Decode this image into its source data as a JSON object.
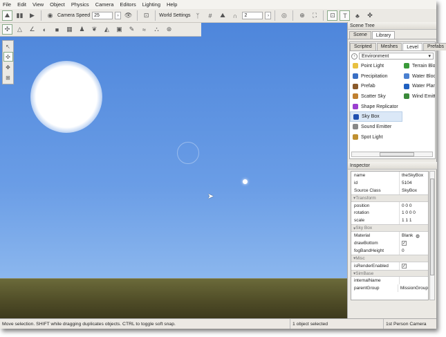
{
  "menu": [
    "File",
    "Edit",
    "View",
    "Object",
    "Physics",
    "Camera",
    "Editors",
    "Lighting",
    "Help"
  ],
  "toolbar": {
    "camera_speed_label": "Camera Speed",
    "camera_speed": "25",
    "world_settings_label": "World Settings",
    "snap_value": "2"
  },
  "scene_tree": {
    "title": "Scene Tree",
    "tabs": [
      "Scene",
      "Library"
    ],
    "active_tab": "Library",
    "sub_tabs": [
      "Scripted",
      "Meshes",
      "Level",
      "Prefabs"
    ],
    "active_sub_tab": "Level",
    "category": "Environment",
    "items_left": [
      {
        "label": "Point Light",
        "color": "#e8c040"
      },
      {
        "label": "Precipitation",
        "color": "#3a6fc4"
      },
      {
        "label": "Prefab",
        "color": "#8a5a2a"
      },
      {
        "label": "Scatter Sky",
        "color": "#c08030"
      },
      {
        "label": "Shape Replicator",
        "color": "#9b3fd0"
      },
      {
        "label": "Sky Box",
        "color": "#2050b0"
      },
      {
        "label": "Sound Emitter",
        "color": "#888888"
      },
      {
        "label": "Spot Light",
        "color": "#c09030"
      }
    ],
    "items_right": [
      {
        "label": "Terrain Block",
        "color": "#3a9a3a"
      },
      {
        "label": "Water Block",
        "color": "#4a80d0"
      },
      {
        "label": "Water Plane",
        "color": "#2060c0"
      },
      {
        "label": "Wind Emitter",
        "color": "#3a8a3a"
      }
    ],
    "selected_item": "Sky Box"
  },
  "inspector": {
    "title": "Inspector",
    "top": [
      {
        "k": "name",
        "v": "theSkyBox"
      },
      {
        "k": "id",
        "v": "5104"
      },
      {
        "k": "Source Class",
        "v": "SkyBox"
      }
    ],
    "groups": [
      {
        "name": "Transform",
        "rows": [
          {
            "k": "position",
            "v": "0 0 0"
          },
          {
            "k": "rotation",
            "v": "1 0 0 0"
          },
          {
            "k": "scale",
            "v": "1 1 1"
          }
        ]
      },
      {
        "name": "Sky Box",
        "rows": [
          {
            "k": "Material",
            "v": "Blank"
          },
          {
            "k": "drawBottom",
            "v": "✓"
          },
          {
            "k": "fogBandHeight",
            "v": "0"
          }
        ]
      },
      {
        "name": "Misc",
        "rows": [
          {
            "k": "isRenderEnabled",
            "v": "✓"
          }
        ]
      },
      {
        "name": "SimBase",
        "rows": [
          {
            "k": "internalName",
            "v": ""
          },
          {
            "k": "parentGroup",
            "v": "MissionGroup"
          }
        ]
      }
    ]
  },
  "status": {
    "hint": "Move selection.  SHIFT while dragging duplicates objects.  CTRL to toggle soft snap.",
    "selection": "1 object selected",
    "camera": "1st Person Camera"
  }
}
